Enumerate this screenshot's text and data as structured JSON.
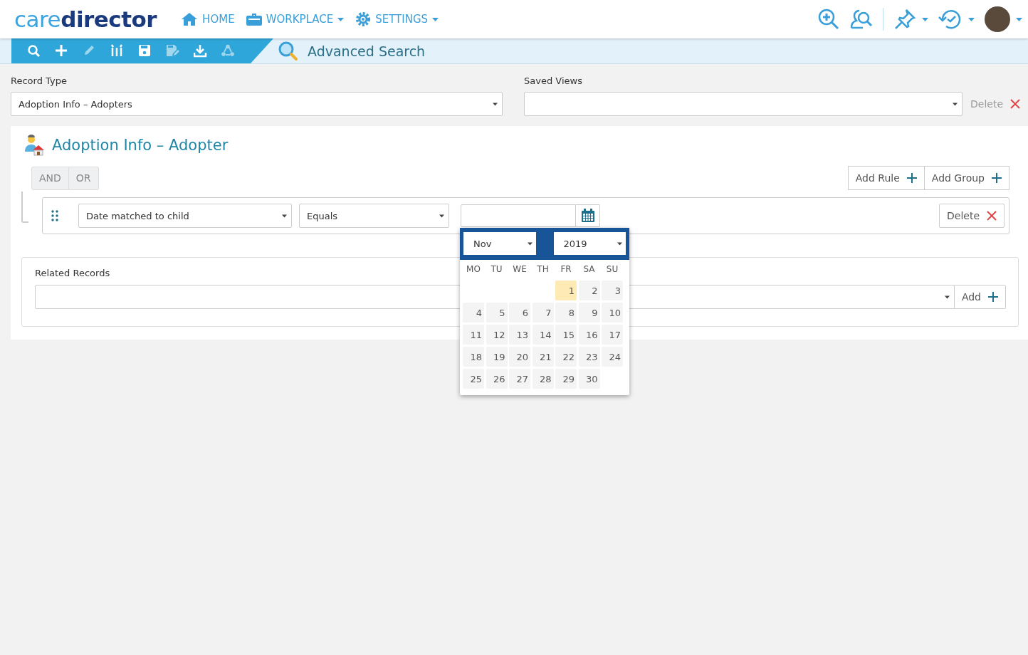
{
  "header": {
    "logo": "care**director**",
    "nav": [
      {
        "label": "HOME",
        "dropdown": false
      },
      {
        "label": "WORKPLACE",
        "dropdown": true
      },
      {
        "label": "SETTINGS",
        "dropdown": true
      }
    ]
  },
  "toolbar": {
    "tools": [
      {
        "disabled": false
      },
      {
        "disabled": false
      },
      {
        "disabled": true
      },
      {
        "disabled": false
      },
      {
        "disabled": false
      },
      {
        "disabled": true
      },
      {
        "disabled": false
      },
      {
        "disabled": true
      }
    ],
    "title": "Advanced Search"
  },
  "record_type": {
    "label": "Record Type",
    "value": "Adoption Info – Adopters"
  },
  "saved_views": {
    "label": "Saved Views",
    "delete_label": "Delete"
  },
  "query": {
    "title": "Adoption Info – Adopter",
    "conditions": [
      {
        "label": "AND"
      },
      {
        "label": "OR"
      }
    ],
    "add_rule": "Add Rule",
    "add_group": "Add Group",
    "rule": {
      "field": "Date matched to child",
      "operator": "Equals",
      "delete_label": "Delete"
    },
    "datepicker": {
      "month": "Nov",
      "year": "2019",
      "weekdays": [
        "MO",
        "TU",
        "WE",
        "TH",
        "FR",
        "SA",
        "SU"
      ],
      "weeks": [
        [
          {
            "day": "1",
            "today": true
          },
          {
            "day": "2",
            "today": false
          },
          {
            "day": "3",
            "today": false
          }
        ],
        [
          {
            "day": "4",
            "today": false
          },
          {
            "day": "5",
            "today": false
          },
          {
            "day": "6",
            "today": false
          },
          {
            "day": "7",
            "today": false
          },
          {
            "day": "8",
            "today": false
          },
          {
            "day": "9",
            "today": false
          },
          {
            "day": "10",
            "today": false
          }
        ],
        [
          {
            "day": "11",
            "today": false
          },
          {
            "day": "12",
            "today": false
          },
          {
            "day": "13",
            "today": false
          },
          {
            "day": "14",
            "today": false
          },
          {
            "day": "15",
            "today": false
          },
          {
            "day": "16",
            "today": false
          },
          {
            "day": "17",
            "today": false
          }
        ],
        [
          {
            "day": "18",
            "today": false
          },
          {
            "day": "19",
            "today": false
          },
          {
            "day": "20",
            "today": false
          },
          {
            "day": "21",
            "today": false
          },
          {
            "day": "22",
            "today": false
          },
          {
            "day": "23",
            "today": false
          },
          {
            "day": "24",
            "today": false
          }
        ],
        [
          {
            "day": "25",
            "today": false
          },
          {
            "day": "26",
            "today": false
          },
          {
            "day": "27",
            "today": false
          },
          {
            "day": "28",
            "today": false
          },
          {
            "day": "29",
            "today": false
          },
          {
            "day": "30",
            "today": false
          }
        ]
      ]
    },
    "related": {
      "label": "Related Records",
      "add_label": "Add"
    }
  }
}
